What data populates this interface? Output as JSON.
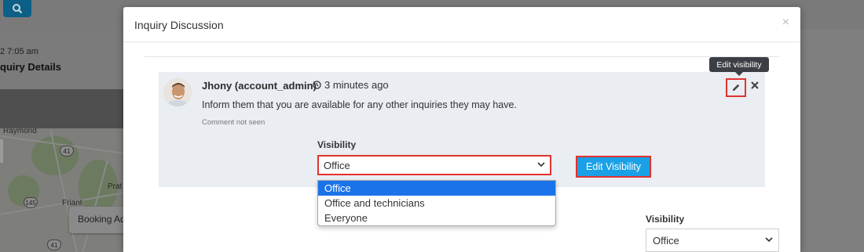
{
  "background": {
    "time_text": "2 7:05 am",
    "details_text": "quiry Details",
    "map_labels": [
      "Raymond",
      "Prat",
      "Friant"
    ],
    "highway_numbers": [
      "41",
      "145",
      "41"
    ],
    "booking_text": "Booking Ad"
  },
  "modal": {
    "title": "Inquiry Discussion",
    "close_symbol": "×"
  },
  "comment": {
    "author": "Jhony (account_admin)",
    "time": "3 minutes ago",
    "message": "Inform them that you are available for any other inquiries they may have.",
    "seen_status": "Comment not seen",
    "visibility_label": "Visibility",
    "visibility_value": "Office",
    "edit_visibility_button": "Edit Visibility",
    "tooltip": "Edit visibility",
    "icons": {
      "edit": "pencil-icon",
      "delete": "close-icon",
      "time": "clock-icon"
    }
  },
  "dropdown": {
    "options": [
      "Office",
      "Office and technicians",
      "Everyone"
    ],
    "selected_index": 0
  },
  "new_comment": {
    "visibility_label": "Visibility",
    "visibility_value": "Office"
  },
  "colors": {
    "accent_button": "#1aa0e6",
    "highlight_border": "#e0332f",
    "selected_option": "#1a73e8",
    "overlay": "#7d7d7d"
  }
}
